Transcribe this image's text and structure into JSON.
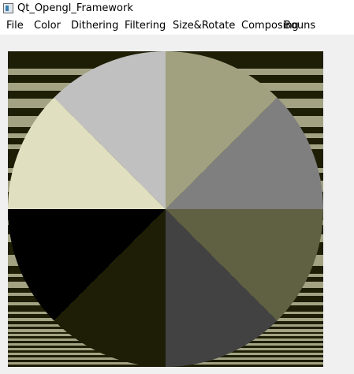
{
  "window": {
    "title": "Qt_Opengl_Framework",
    "icon": "app-window-icon"
  },
  "menubar": {
    "items": [
      {
        "label": "File"
      },
      {
        "label": "Color"
      },
      {
        "label": "Dithering"
      },
      {
        "label": "Filtering"
      },
      {
        "label": "Size&Rotate"
      },
      {
        "label": "Composing"
      },
      {
        "label": "Bouns"
      }
    ]
  },
  "canvas": {
    "background_color": "#1e1e06",
    "stripe_color": "#a3a384",
    "pie_slice_colors": [
      "#a1a17f",
      "#7f7f7f",
      "#606043",
      "#424242",
      "#1e1e06",
      "#000000",
      "#e0e0c0",
      "#c0c0c0"
    ]
  }
}
